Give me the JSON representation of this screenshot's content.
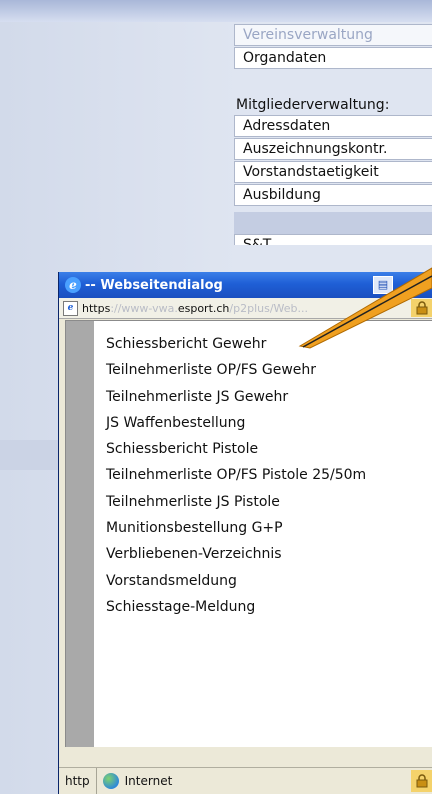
{
  "background_menu": {
    "faded_item": "Vereinsverwaltung",
    "items_top": [
      "Organdaten"
    ],
    "section_title": "Mitgliederverwaltung:",
    "items": [
      "Adressdaten",
      "Auszeichnungskontr.",
      "Vorstandstaetigkeit",
      "Ausbildung"
    ],
    "cut_item": "S&T"
  },
  "dialog": {
    "title": "-- Webseitendialog",
    "address": {
      "part_a": "https",
      "part_b": "://www-vwa.",
      "part_c": "esport.ch",
      "part_d": "/p2plus/Web..."
    },
    "reports": [
      "Schiessbericht Gewehr",
      "Teilnehmerliste OP/FS Gewehr",
      "Teilnehmerliste JS Gewehr",
      "JS Waffenbestellung",
      "Schiessbericht Pistole",
      "Teilnehmerliste OP/FS Pistole 25/50m",
      "Teilnehmerliste JS Pistole",
      "Munitionsbestellung G+P",
      "Verbliebenen-Verzeichnis",
      "Vorstandsmeldung",
      "Schiesstage-Meldung"
    ],
    "status": {
      "left": "http",
      "zone": "Internet"
    }
  },
  "icons": {
    "title_icon": "ie-icon",
    "page_icon": "ie-page-icon",
    "lock_icon": "lock-icon",
    "globe_icon": "internet-zone-icon"
  },
  "colors": {
    "titlebar": "#1f5fd6",
    "callout": "#f0a020"
  }
}
